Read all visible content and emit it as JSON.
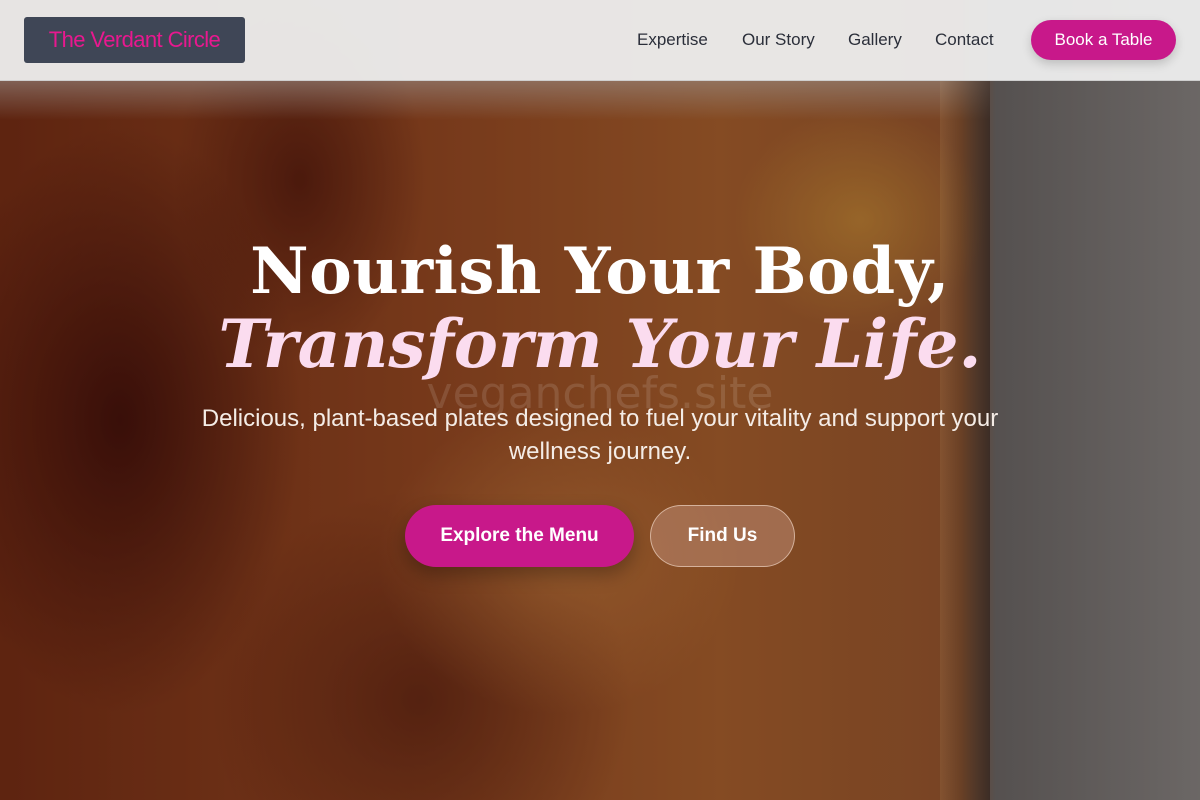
{
  "brand": {
    "logo_text": "The Verdant Circle"
  },
  "nav": {
    "items": [
      {
        "label": "Expertise"
      },
      {
        "label": "Our Story"
      },
      {
        "label": "Gallery"
      },
      {
        "label": "Contact"
      }
    ],
    "cta_label": "Book a Table"
  },
  "hero": {
    "title_line1": "Nourish Your Body,",
    "title_line2": "Transform Your Life.",
    "subtitle": "Delicious, plant-based plates designed to fuel your vitality and support your wellness journey.",
    "primary_button": "Explore the Menu",
    "secondary_button": "Find Us",
    "watermark": "veganchefs.site"
  },
  "colors": {
    "accent": "#c8188a",
    "logo_text": "#e8188f",
    "logo_bg": "#3f4656",
    "header_bg": "#ececec",
    "title_accent": "#fbdcef"
  }
}
